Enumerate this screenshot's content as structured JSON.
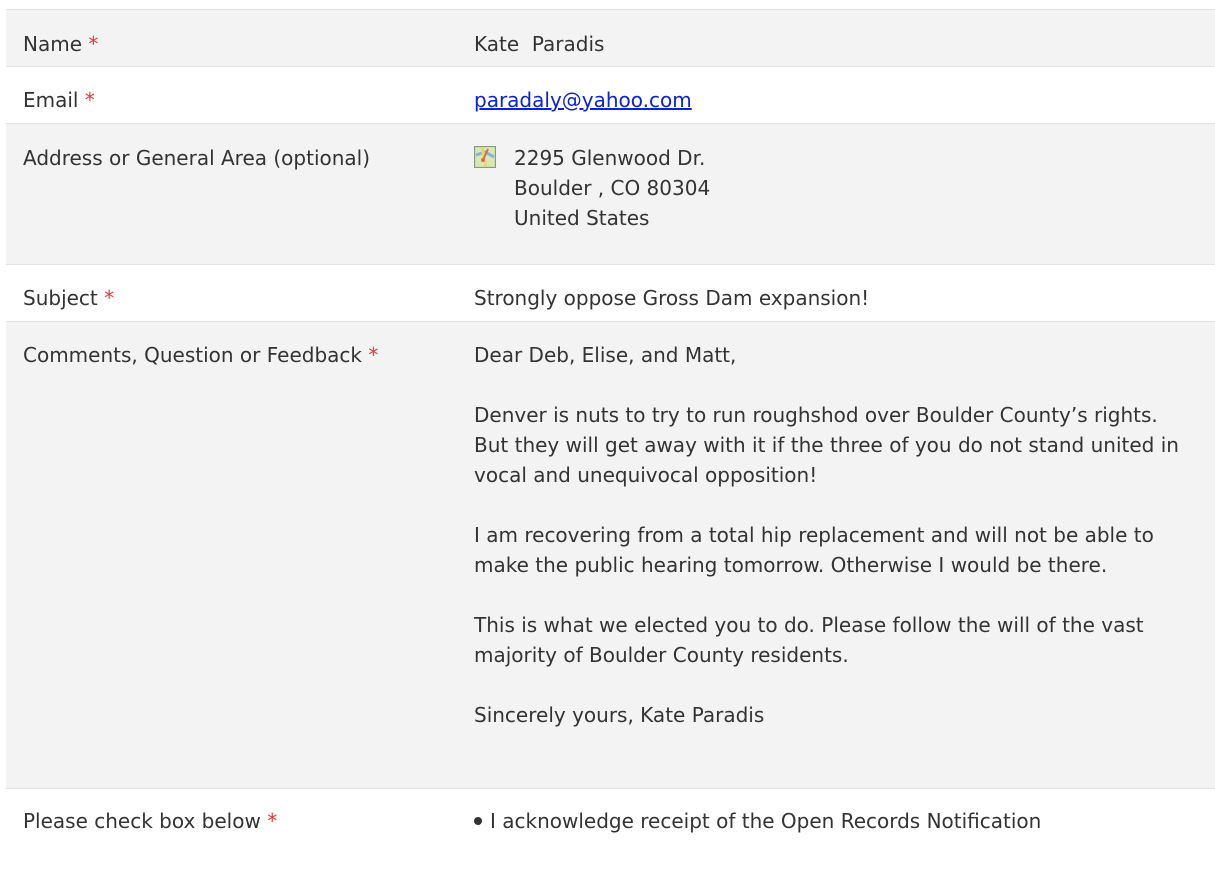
{
  "required_marker": "*",
  "rows": {
    "name": {
      "label": "Name",
      "value": "Kate  Paradis"
    },
    "email": {
      "label": "Email",
      "value": "paradaly@yahoo.com"
    },
    "address": {
      "label": "Address or General Area (optional)",
      "line1": "2295 Glenwood Dr.",
      "line2": "Boulder , CO 80304",
      "line3": "United States",
      "icon": "map-icon"
    },
    "subject": {
      "label": "Subject",
      "value": "Strongly oppose Gross Dam expansion!"
    },
    "comments": {
      "label": "Comments, Question or Feedback",
      "paragraphs": [
        "Dear Deb, Elise, and Matt,",
        "Denver is nuts to try to run roughshod over Boulder County’s rights. But they will get away with it if the three of you do not stand united in vocal and unequivocal opposition!",
        "I am recovering from a total hip replacement and will not be able to make the public hearing tomorrow. Otherwise I would be there.",
        "This is what we elected you to do. Please follow the will of the vast majority of Boulder County residents.",
        "Sincerely yours, Kate Paradis"
      ]
    },
    "check": {
      "label": "Please check box below",
      "item": "I acknowledge receipt of the Open Records Notification"
    }
  },
  "colors": {
    "required": "#e8392f",
    "link": "#0b22d8",
    "row_shade": "#f3f3f3",
    "border": "#e2e2e2",
    "text": "#333333"
  }
}
